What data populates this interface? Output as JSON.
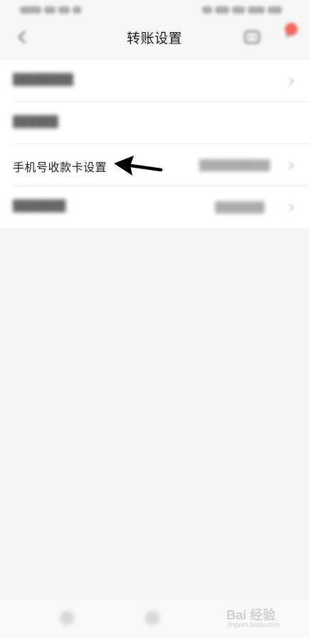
{
  "nav": {
    "title": "转账设置",
    "back_icon": "back-arrow-icon",
    "service_icon": "customer-service-icon",
    "more_icon": "more-menu-icon"
  },
  "settings": {
    "items": [
      {
        "label": "",
        "value": ""
      },
      {
        "label": "",
        "value": ""
      },
      {
        "label": "手机号收款卡设置",
        "value": ""
      },
      {
        "label": "",
        "value": ""
      }
    ]
  },
  "watermark": {
    "text": "Bai 经验",
    "subtext": "jingyan.baidu.com"
  },
  "colors": {
    "background": "#f5f5f5",
    "card": "#ffffff",
    "title": "#1a1a1a",
    "badge": "#f26a5c"
  }
}
